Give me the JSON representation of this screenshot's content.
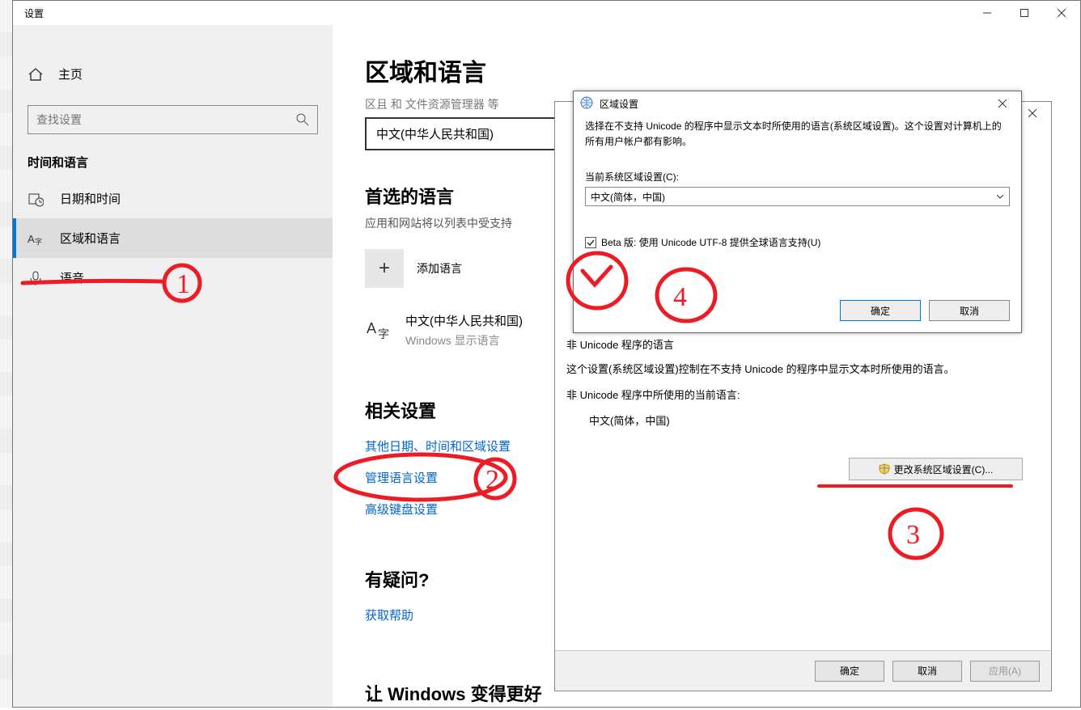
{
  "settings": {
    "window_title": "设置",
    "home": "主页",
    "search_placeholder": "查找设置",
    "category": "时间和语言",
    "nav": {
      "date_time": "日期和时间",
      "region_lang": "区域和语言",
      "speech": "语音"
    }
  },
  "content": {
    "page_title": "区域和语言",
    "sub_line": "区且 和 文件资源管理器 等",
    "country_dropdown": "中文(中华人民共和国)",
    "preferred_head": "首选的语言",
    "preferred_desc": "应用和网站将以列表中受支持",
    "add_lang": "添加语言",
    "lang1": {
      "name": "中文(中华人民共和国)",
      "sub": "Windows 显示语言"
    },
    "related_head": "相关设置",
    "link1": "其他日期、时间和区域设置",
    "link2": "管理语言设置",
    "link3": "高级键盘设置",
    "q_head": "有疑问?",
    "q_link": "获取帮助",
    "bottom_head": "让 Windows 变得更好"
  },
  "region_dialog": {
    "section_top": "非 Unicode 程序的语言",
    "desc": "这个设置(系统区域设置)控制在不支持 Unicode 的程序中显示文本时所使用的语言。",
    "cur_label": "非 Unicode 程序中所使用的当前语言:",
    "cur_value": "中文(简体，中国)",
    "change_btn": "更改系统区域设置(C)...",
    "ok": "确定",
    "cancel": "取消",
    "apply": "应用(A)"
  },
  "locale_dialog": {
    "title": "区域设置",
    "desc": "选择在不支持 Unicode 的程序中显示文本时所使用的语言(系统区域设置)。这个设置对计算机上的所有用户帐户都有影响。",
    "label": "当前系统区域设置(C):",
    "value": "中文(简体，中国)",
    "check_label": "Beta 版: 使用 Unicode UTF-8 提供全球语言支持(U)",
    "ok": "确定",
    "cancel": "取消"
  }
}
